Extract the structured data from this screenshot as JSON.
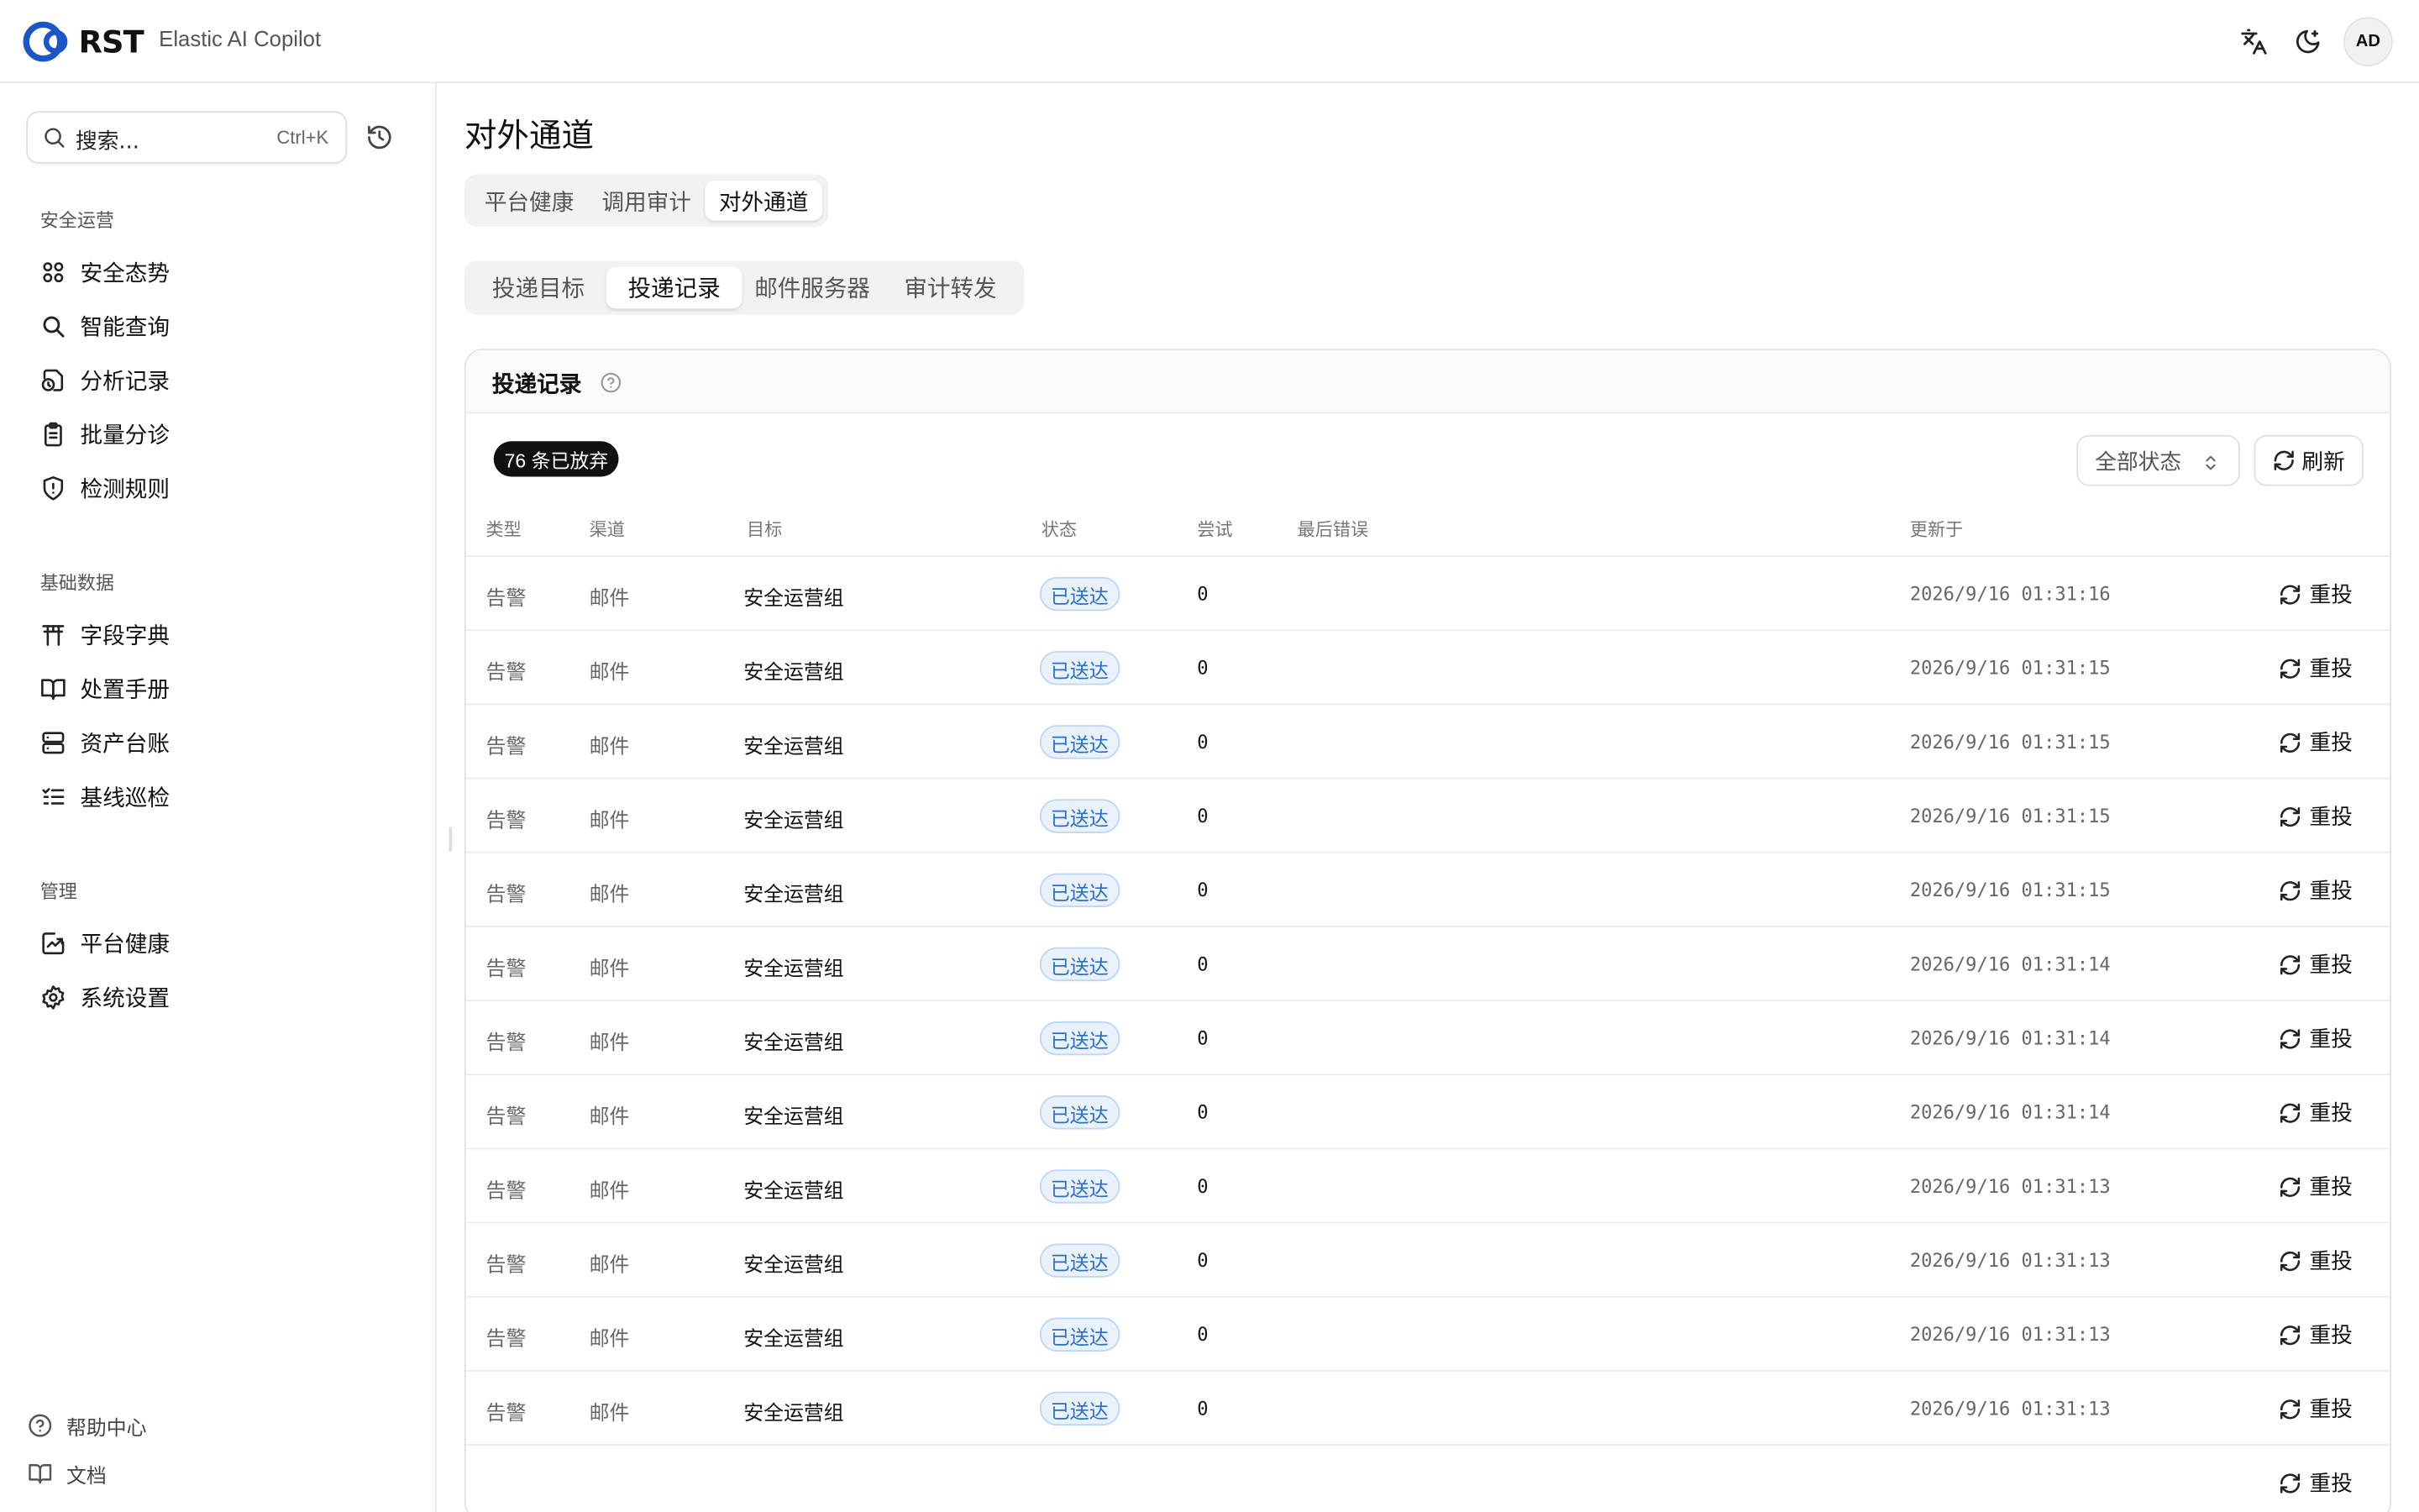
{
  "header": {
    "logo_text": "RST",
    "app_name": "Elastic AI Copilot",
    "avatar": "AD"
  },
  "sidebar": {
    "search_placeholder": "搜索...",
    "search_shortcut": "Ctrl+K",
    "sections": [
      {
        "title": "安全运营",
        "items": [
          {
            "label": "安全态势",
            "icon": "grid-icon"
          },
          {
            "label": "智能查询",
            "icon": "search-icon"
          },
          {
            "label": "分析记录",
            "icon": "history-file-icon"
          },
          {
            "label": "批量分诊",
            "icon": "clipboard-icon"
          },
          {
            "label": "检测规则",
            "icon": "shield-alert-icon"
          }
        ]
      },
      {
        "title": "基础数据",
        "items": [
          {
            "label": "字段字典",
            "icon": "torii-icon"
          },
          {
            "label": "处置手册",
            "icon": "book-icon"
          },
          {
            "label": "资产台账",
            "icon": "server-icon"
          },
          {
            "label": "基线巡检",
            "icon": "checklist-icon"
          }
        ]
      },
      {
        "title": "管理",
        "items": [
          {
            "label": "平台健康",
            "icon": "chart-icon"
          },
          {
            "label": "系统设置",
            "icon": "gear-icon"
          }
        ]
      }
    ],
    "footer": [
      {
        "label": "帮助中心",
        "icon": "help-circle-icon"
      },
      {
        "label": "文档",
        "icon": "book-open-icon"
      }
    ]
  },
  "main": {
    "title": "对外通道",
    "tabs": [
      "平台健康",
      "调用审计",
      "对外通道"
    ],
    "active_tab": 2,
    "subtabs": [
      "投递目标",
      "投递记录",
      "邮件服务器",
      "审计转发"
    ],
    "active_subtab": 1,
    "card": {
      "title": "投递记录",
      "badge": "76 条已放弃",
      "filter_value": "全部状态",
      "refresh_label": "刷新",
      "columns": [
        "类型",
        "渠道",
        "目标",
        "状态",
        "尝试",
        "最后错误",
        "更新于"
      ],
      "action_label": "重投",
      "rows": [
        {
          "type": "告警",
          "channel": "邮件",
          "target": "安全运营组",
          "status": "已送达",
          "attempts": "0",
          "error": "",
          "updated": "2026/9/16 01:31:16"
        },
        {
          "type": "告警",
          "channel": "邮件",
          "target": "安全运营组",
          "status": "已送达",
          "attempts": "0",
          "error": "",
          "updated": "2026/9/16 01:31:15"
        },
        {
          "type": "告警",
          "channel": "邮件",
          "target": "安全运营组",
          "status": "已送达",
          "attempts": "0",
          "error": "",
          "updated": "2026/9/16 01:31:15"
        },
        {
          "type": "告警",
          "channel": "邮件",
          "target": "安全运营组",
          "status": "已送达",
          "attempts": "0",
          "error": "",
          "updated": "2026/9/16 01:31:15"
        },
        {
          "type": "告警",
          "channel": "邮件",
          "target": "安全运营组",
          "status": "已送达",
          "attempts": "0",
          "error": "",
          "updated": "2026/9/16 01:31:15"
        },
        {
          "type": "告警",
          "channel": "邮件",
          "target": "安全运营组",
          "status": "已送达",
          "attempts": "0",
          "error": "",
          "updated": "2026/9/16 01:31:14"
        },
        {
          "type": "告警",
          "channel": "邮件",
          "target": "安全运营组",
          "status": "已送达",
          "attempts": "0",
          "error": "",
          "updated": "2026/9/16 01:31:14"
        },
        {
          "type": "告警",
          "channel": "邮件",
          "target": "安全运营组",
          "status": "已送达",
          "attempts": "0",
          "error": "",
          "updated": "2026/9/16 01:31:14"
        },
        {
          "type": "告警",
          "channel": "邮件",
          "target": "安全运营组",
          "status": "已送达",
          "attempts": "0",
          "error": "",
          "updated": "2026/9/16 01:31:13"
        },
        {
          "type": "告警",
          "channel": "邮件",
          "target": "安全运营组",
          "status": "已送达",
          "attempts": "0",
          "error": "",
          "updated": "2026/9/16 01:31:13"
        },
        {
          "type": "告警",
          "channel": "邮件",
          "target": "安全运营组",
          "status": "已送达",
          "attempts": "0",
          "error": "",
          "updated": "2026/9/16 01:31:13"
        },
        {
          "type": "告警",
          "channel": "邮件",
          "target": "安全运营组",
          "status": "已送达",
          "attempts": "0",
          "error": "",
          "updated": "2026/9/16 01:31:13"
        },
        {
          "type": "",
          "channel": "",
          "target": "",
          "status": "",
          "attempts": "",
          "error": "",
          "updated": ""
        }
      ]
    }
  },
  "colors": {
    "accent": "#1a56c4",
    "status_bg": "#e8f1fc",
    "status_text": "#2b6fc2"
  }
}
